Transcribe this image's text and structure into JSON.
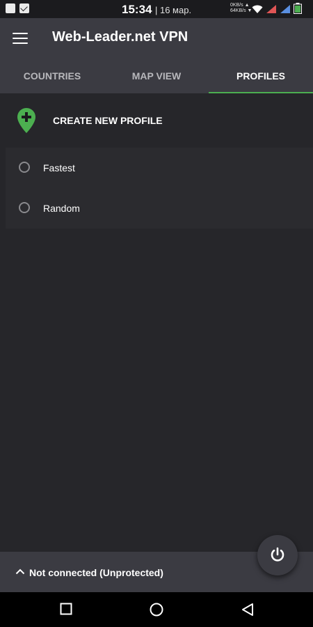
{
  "status_bar": {
    "time": "15:34",
    "date": "| 16 мар.",
    "speed_up": "0KB/s ▲",
    "speed_down": "64KB/s ▼"
  },
  "app_bar": {
    "title": "Web-Leader.net VPN",
    "menu_icon": "hamburger-menu-icon"
  },
  "tabs": [
    {
      "label": "COUNTRIES",
      "active": false
    },
    {
      "label": "MAP VIEW",
      "active": false
    },
    {
      "label": "PROFILES",
      "active": true
    }
  ],
  "create_profile": {
    "label": "CREATE NEW PROFILE",
    "icon": "add-location-pin-icon"
  },
  "profiles": [
    {
      "label": "Fastest",
      "selected": false
    },
    {
      "label": "Random",
      "selected": false
    }
  ],
  "connection": {
    "status": "Not connected (Unprotected)",
    "icon": "chevron-up-icon"
  },
  "fab": {
    "icon": "power-icon"
  },
  "nav": {
    "icons": [
      "square-recents-icon",
      "circle-home-icon",
      "triangle-back-icon"
    ]
  },
  "colors": {
    "background": "#26262a",
    "toolbar": "#3b3b42",
    "accent": "#4caf50",
    "inactive_tab": "#b8b8bc"
  }
}
